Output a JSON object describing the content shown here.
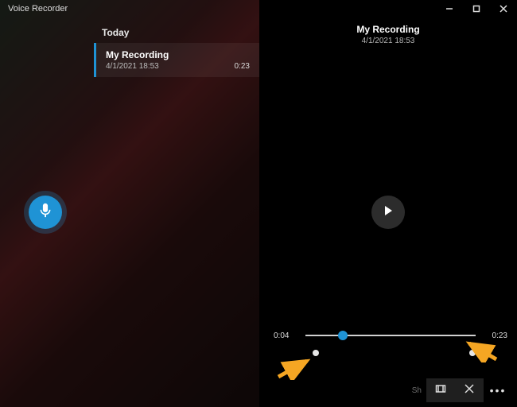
{
  "app": {
    "title": "Voice Recorder"
  },
  "colors": {
    "accent": "#1f93d5"
  },
  "list": {
    "group": "Today",
    "items": [
      {
        "name": "My Recording",
        "datetime": "4/1/2021 18:53",
        "duration": "0:23"
      }
    ]
  },
  "detail": {
    "title": "My Recording",
    "datetime": "4/1/2021 18:53"
  },
  "playback": {
    "position_text": "0:04",
    "duration_text": "0:23",
    "progress_percent": 22,
    "markers_percent": [
      6,
      98
    ]
  },
  "toolbar": {
    "share_label": "Sh",
    "trim_icon": "trim",
    "delete_icon": "delete",
    "more_icon": "more"
  }
}
